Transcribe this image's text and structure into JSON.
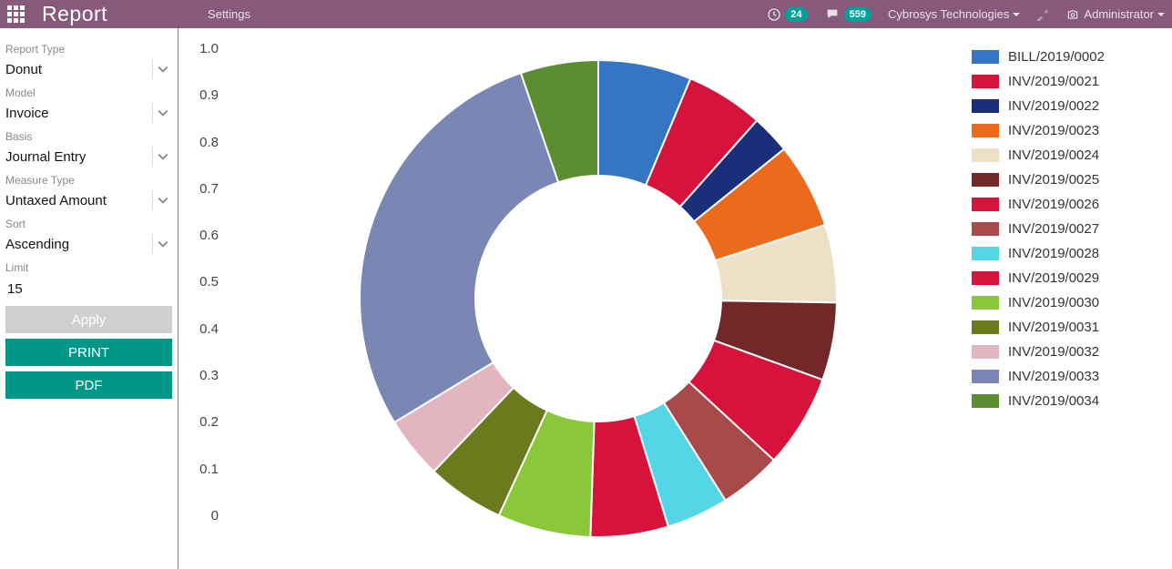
{
  "topbar": {
    "brand": "Report",
    "nav_settings": "Settings",
    "planner_count": "24",
    "chat_count": "559",
    "company": "Cybrosys Technologies",
    "user": "Administrator"
  },
  "sidebar": {
    "report_type_label": "Report Type",
    "report_type_value": "Donut",
    "model_label": "Model",
    "model_value": "Invoice",
    "basis_label": "Basis",
    "basis_value": "Journal Entry",
    "measure_type_label": "Measure Type",
    "measure_type_value": "Untaxed Amount",
    "sort_label": "Sort",
    "sort_value": "Ascending",
    "limit_label": "Limit",
    "limit_value": "15",
    "apply": "Apply",
    "print": "PRINT",
    "pdf": "PDF"
  },
  "axis_ticks": [
    "1.0",
    "0.9",
    "0.8",
    "0.7",
    "0.6",
    "0.5",
    "0.4",
    "0.3",
    "0.2",
    "0.1",
    "0"
  ],
  "chart_data": {
    "type": "donut",
    "title": "",
    "series": [
      {
        "name": "BILL/2019/0002",
        "value": 6.0,
        "color": "#3476c4"
      },
      {
        "name": "INV/2019/0021",
        "value": 5.0,
        "color": "#d6133a"
      },
      {
        "name": "INV/2019/0022",
        "value": 2.5,
        "color": "#1b2e7a"
      },
      {
        "name": "INV/2019/0023",
        "value": 5.5,
        "color": "#ec6a1c"
      },
      {
        "name": "INV/2019/0024",
        "value": 5.0,
        "color": "#eee0c7"
      },
      {
        "name": "INV/2019/0025",
        "value": 5.0,
        "color": "#722728"
      },
      {
        "name": "INV/2019/0026",
        "value": 6.0,
        "color": "#d6133a"
      },
      {
        "name": "INV/2019/0027",
        "value": 4.0,
        "color": "#a84a4a"
      },
      {
        "name": "INV/2019/0028",
        "value": 4.0,
        "color": "#55d6e7"
      },
      {
        "name": "INV/2019/0029",
        "value": 5.0,
        "color": "#d6133a"
      },
      {
        "name": "INV/2019/0030",
        "value": 6.0,
        "color": "#8bc73a"
      },
      {
        "name": "INV/2019/0031",
        "value": 5.0,
        "color": "#6a7a1d"
      },
      {
        "name": "INV/2019/0032",
        "value": 4.0,
        "color": "#e2b6c1"
      },
      {
        "name": "INV/2019/0033",
        "value": 27.0,
        "color": "#7a87b5"
      },
      {
        "name": "INV/2019/0034",
        "value": 5.0,
        "color": "#5a8e30"
      }
    ]
  }
}
